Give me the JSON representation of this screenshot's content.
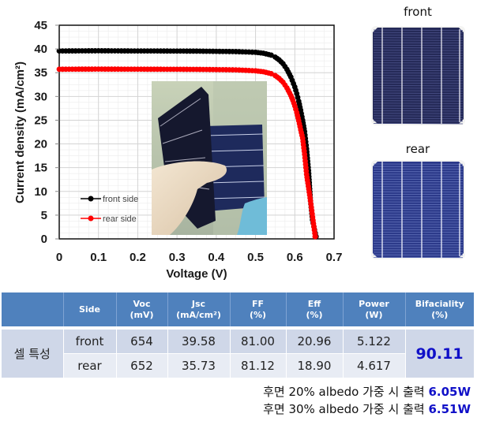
{
  "chart_data": {
    "type": "line",
    "title": "",
    "xlabel": "Voltage (V)",
    "ylabel": "Current density (mA/cm²)",
    "xlim": [
      0,
      0.7
    ],
    "ylim": [
      0,
      45
    ],
    "xticks": [
      "0",
      "0.1",
      "0.2",
      "0.3",
      "0.4",
      "0.5",
      "0.6",
      "0.7"
    ],
    "yticks": [
      "0",
      "5",
      "10",
      "15",
      "20",
      "25",
      "30",
      "35",
      "40",
      "45"
    ],
    "grid": true,
    "legend_position": "lower-left",
    "series": [
      {
        "name": "front side",
        "color": "#000000",
        "x": [
          0,
          0.05,
          0.1,
          0.15,
          0.2,
          0.25,
          0.3,
          0.35,
          0.4,
          0.45,
          0.5,
          0.52,
          0.54,
          0.55,
          0.56,
          0.57,
          0.58,
          0.59,
          0.6,
          0.605,
          0.61,
          0.615,
          0.62,
          0.625,
          0.63,
          0.635,
          0.64,
          0.645,
          0.654
        ],
        "y": [
          39.58,
          39.6,
          39.62,
          39.6,
          39.58,
          39.58,
          39.56,
          39.55,
          39.5,
          39.45,
          39.3,
          39.1,
          38.7,
          38.3,
          37.7,
          36.9,
          35.7,
          34.1,
          32.0,
          30.6,
          29.0,
          27.1,
          25.0,
          22.6,
          19.0,
          14.4,
          8.0,
          4.0,
          0.5
        ]
      },
      {
        "name": "rear side",
        "color": "#ff0000",
        "x": [
          0,
          0.05,
          0.1,
          0.15,
          0.2,
          0.25,
          0.3,
          0.35,
          0.4,
          0.45,
          0.5,
          0.52,
          0.54,
          0.55,
          0.56,
          0.57,
          0.58,
          0.59,
          0.595,
          0.6,
          0.605,
          0.61,
          0.615,
          0.62,
          0.625,
          0.63,
          0.64,
          0.652
        ],
        "y": [
          35.73,
          35.75,
          35.76,
          35.75,
          35.74,
          35.73,
          35.72,
          35.7,
          35.65,
          35.6,
          35.4,
          35.2,
          34.8,
          34.4,
          33.8,
          33.0,
          31.8,
          30.2,
          29.2,
          28.0,
          26.6,
          24.9,
          23.0,
          21.2,
          17.8,
          13.6,
          8.0,
          0.5
        ]
      }
    ]
  },
  "photos": {
    "front_label": "front",
    "rear_label": "rear"
  },
  "table": {
    "headers": [
      {
        "line1": "",
        "line2": ""
      },
      {
        "line1": "Side",
        "line2": ""
      },
      {
        "line1": "Voc",
        "line2": "(mV)"
      },
      {
        "line1": "Jsc",
        "line2": "(mA/cm²)"
      },
      {
        "line1": "FF",
        "line2": "(%)"
      },
      {
        "line1": "Eff",
        "line2": "(%)"
      },
      {
        "line1": "Power",
        "line2": "(W)"
      },
      {
        "line1": "Bifaciality",
        "line2": "(%)"
      }
    ],
    "group_label": "셀 특성",
    "rows": [
      {
        "side": "front",
        "voc": "654",
        "jsc": "39.58",
        "ff": "81.00",
        "eff": "20.96",
        "power": "5.122"
      },
      {
        "side": "rear",
        "voc": "652",
        "jsc": "35.73",
        "ff": "81.12",
        "eff": "18.90",
        "power": "4.617"
      }
    ],
    "bifaciality": "90.11"
  },
  "notes": [
    {
      "text": "후면 20% albedo 가중 시 출력 ",
      "value": "6.05W"
    },
    {
      "text": "후면 30% albedo 가중 시 출력 ",
      "value": "6.51W"
    }
  ]
}
